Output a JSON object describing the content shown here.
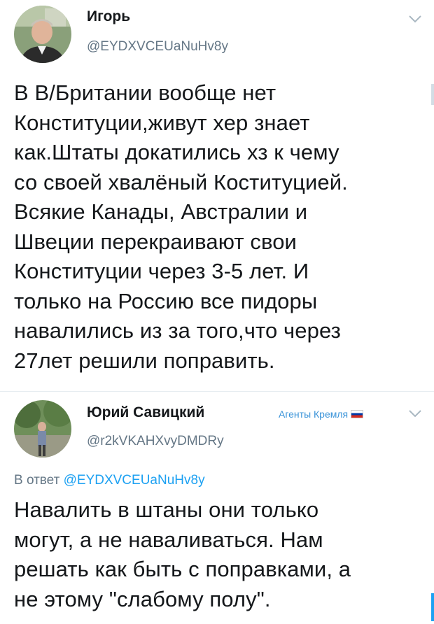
{
  "tweets": [
    {
      "author_name": "Игорь",
      "author_handle": "@EYDXVCEUaNuHv8y",
      "body": "В В/Британии вообще нет\nКонституции,живут хер знает\nкак.Штаты докатились хз к чему\nсо своей хвалёный Коституцией.\nВсякие Канады, Австралии и\nШвеции перекраивают свои\nКонституции через 3-5 лет. И\nтолько на Россию все пидоры\nнавалились из за того,что через\n27лет решили поправить.",
      "avatar_icon": "user-avatar-photo",
      "menu_icon": "chevron-down-icon"
    },
    {
      "author_name": "Юрий Савицкий",
      "author_handle": "@r2kVKAHXvyDMDRy",
      "badge_text": "Агенты Кремля",
      "badge_icon": "russia-flag-icon",
      "reply_prefix": "В ответ",
      "reply_handle": "@EYDXVCEUaNuHv8y",
      "body": "Навалить в штаны они только\nмогут, а не наваливаться. Нам\nрешать как быть с поправками, а\nне этому \"слабому полу\".",
      "avatar_icon": "user-avatar-photo",
      "menu_icon": "chevron-down-icon"
    }
  ],
  "colors": {
    "text": "#14171a",
    "secondary": "#657786",
    "link": "#1da1f2",
    "badge": "#3b94d9",
    "separator": "#e6ecf0"
  }
}
